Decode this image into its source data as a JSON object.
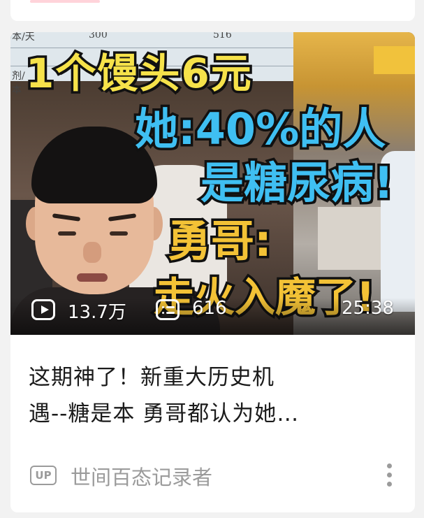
{
  "thumbnail": {
    "overlay_lines": [
      "1个馒头6元",
      "她:40%的人",
      "是糖尿病!",
      "勇哥:",
      "走火入魔了!"
    ],
    "background_table_text": [
      "本/天",
      "300",
      "516",
      "剂/",
      "本"
    ],
    "views": "13.7万",
    "danmaku": "616",
    "duration": "25:38"
  },
  "video": {
    "title_line1": "这期神了！新重大历史机",
    "title_line2": "遇--糖是本 勇哥都认为她…"
  },
  "uploader": {
    "badge": "UP",
    "name": "世间百态记录者"
  },
  "icons": [
    "play-icon",
    "danmaku-icon",
    "up-badge-icon",
    "more-icon"
  ],
  "colors": {
    "page_bg": "#f2f2f2",
    "card_bg": "#ffffff",
    "title_text": "#1b1b1b",
    "secondary_text": "#9b9b9b",
    "overlay_yellow": "#f6e24a",
    "overlay_blue": "#3fbff2",
    "overlay_orange": "#f3c236"
  }
}
